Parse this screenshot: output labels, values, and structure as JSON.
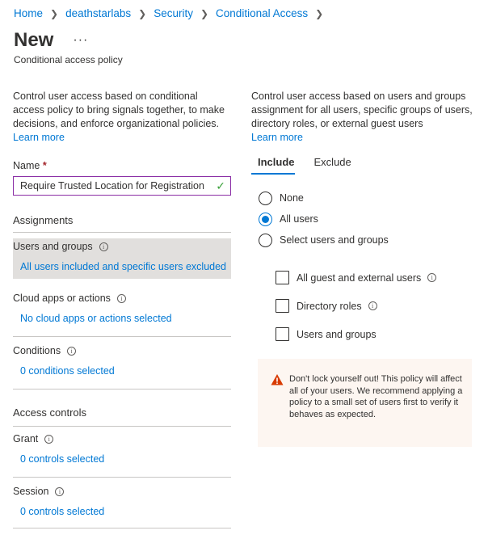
{
  "breadcrumb": [
    "Home",
    "deathstarlabs",
    "Security",
    "Conditional Access"
  ],
  "header": {
    "title": "New",
    "more": "···",
    "subtitle": "Conditional access policy"
  },
  "left": {
    "intro": "Control user access based on conditional access policy to bring signals together, to make decisions, and enforce organizational policies.",
    "learn_more": "Learn more",
    "name_label": "Name",
    "required_mark": "*",
    "name_value": "Require Trusted Location for Registration",
    "assignments_heading": "Assignments",
    "users_label": "Users and groups",
    "users_value": "All users included and specific users excluded",
    "cloud_label": "Cloud apps or actions",
    "cloud_value": "No cloud apps or actions selected",
    "conditions_label": "Conditions",
    "conditions_value": "0 conditions selected",
    "access_heading": "Access controls",
    "grant_label": "Grant",
    "grant_value": "0 controls selected",
    "session_label": "Session",
    "session_value": "0 controls selected"
  },
  "right": {
    "intro": "Control user access based on users and groups assignment for all users, specific groups of users, directory roles, or external guest users",
    "learn_more": "Learn more",
    "tabs": [
      "Include",
      "Exclude"
    ],
    "radios": [
      {
        "label": "None",
        "selected": false
      },
      {
        "label": "All users",
        "selected": true
      },
      {
        "label": "Select users and groups",
        "selected": false
      }
    ],
    "checkboxes": [
      {
        "label": "All guest and external users",
        "checked": false
      },
      {
        "label": "Directory roles",
        "checked": false
      },
      {
        "label": "Users and groups",
        "checked": false
      }
    ],
    "warning": "Don't lock yourself out! This policy will affect all of your users. We recommend applying a policy to a small set of users first to verify it behaves as expected."
  },
  "colors": {
    "accent": "#0078d4",
    "warning": "#d83b01",
    "warning_bg": "#fdf6f1",
    "selected_bg": "#e1dfdd"
  },
  "icons": [
    "chevron-right-icon",
    "more-icon",
    "checkmark-icon",
    "info-icon",
    "warning-icon"
  ]
}
